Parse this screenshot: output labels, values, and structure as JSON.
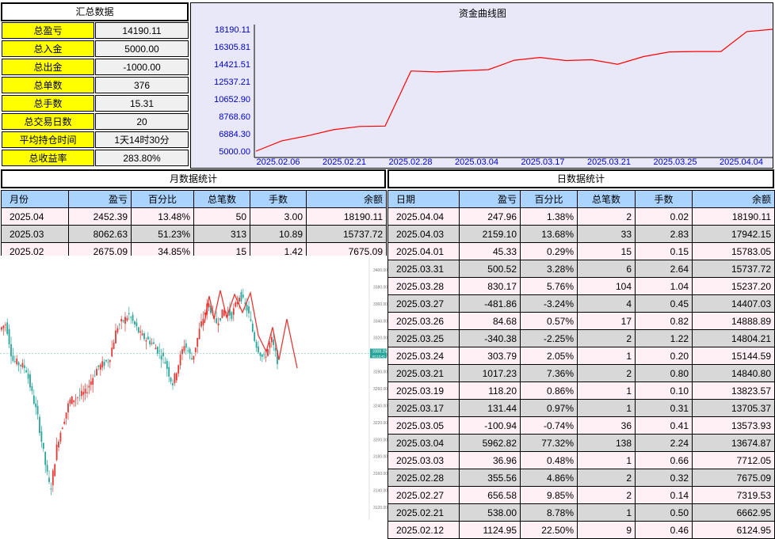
{
  "summary": {
    "title": "汇总数据",
    "rows": [
      {
        "label": "总盈亏",
        "value": "14190.11"
      },
      {
        "label": "总入金",
        "value": "5000.00"
      },
      {
        "label": "总出金",
        "value": "-1000.00"
      },
      {
        "label": "总单数",
        "value": "376"
      },
      {
        "label": "总手数",
        "value": "15.31"
      },
      {
        "label": "总交易日数",
        "value": "20"
      },
      {
        "label": "平均持仓时间",
        "value": "1天14时30分"
      },
      {
        "label": "总收益率",
        "value": "283.80%"
      }
    ]
  },
  "chart_data": {
    "type": "line",
    "title": "资金曲线图",
    "x_labels": [
      "2025.02.06",
      "2025.02.21",
      "2025.02.28",
      "2025.03.04",
      "2025.03.17",
      "2025.03.21",
      "2025.03.25",
      "2025.04.04"
    ],
    "y_ticks": [
      "18190.11",
      "16305.81",
      "14421.51",
      "12537.21",
      "10652.90",
      "8768.60",
      "6884.30",
      "5000.00"
    ],
    "ylim": [
      5000.0,
      18190.11
    ],
    "values": [
      5000,
      6124.95,
      6662.95,
      7319.53,
      7675.09,
      7712.05,
      13674.87,
      13573.93,
      13705.37,
      13823.57,
      14840.8,
      15144.59,
      14804.21,
      14888.89,
      14407.03,
      15237.2,
      15737.72,
      15783.05,
      15783.05,
      17942.15,
      18190.11
    ],
    "line_color": "#ff0000",
    "background": "#e8e8f8",
    "tick_color": "#0000cc"
  },
  "monthly": {
    "title": "月数据统计",
    "headers": [
      "月份",
      "盈亏",
      "百分比",
      "总笔数",
      "手数",
      "余额"
    ],
    "rows": [
      [
        "2025.04",
        "2452.39",
        "13.48%",
        "50",
        "3.00",
        "18190.11"
      ],
      [
        "2025.03",
        "8062.63",
        "51.23%",
        "313",
        "10.89",
        "15737.72"
      ],
      [
        "2025.02",
        "2675.09",
        "34.85%",
        "15",
        "1.42",
        "7675.09"
      ]
    ]
  },
  "daily": {
    "title": "日数据统计",
    "headers": [
      "日期",
      "盈亏",
      "百分比",
      "总笔数",
      "手数",
      "余额"
    ],
    "rows": [
      [
        "2025.04.04",
        "247.96",
        "1.38%",
        "2",
        "0.02",
        "18190.11"
      ],
      [
        "2025.04.03",
        "2159.10",
        "13.68%",
        "33",
        "2.83",
        "17942.15"
      ],
      [
        "2025.04.01",
        "45.33",
        "0.29%",
        "15",
        "0.15",
        "15783.05"
      ],
      [
        "2025.03.31",
        "500.52",
        "3.28%",
        "6",
        "2.64",
        "15737.72"
      ],
      [
        "2025.03.28",
        "830.17",
        "5.76%",
        "104",
        "1.04",
        "15237.20"
      ],
      [
        "2025.03.27",
        "-481.86",
        "-3.24%",
        "4",
        "0.45",
        "14407.03"
      ],
      [
        "2025.03.26",
        "84.68",
        "0.57%",
        "17",
        "0.82",
        "14888.89"
      ],
      [
        "2025.03.25",
        "-340.38",
        "-2.25%",
        "2",
        "1.22",
        "14804.21"
      ],
      [
        "2025.03.24",
        "303.79",
        "2.05%",
        "1",
        "0.20",
        "15144.59"
      ],
      [
        "2025.03.21",
        "1017.23",
        "7.36%",
        "2",
        "0.80",
        "14840.80"
      ],
      [
        "2025.03.19",
        "118.20",
        "0.86%",
        "1",
        "0.10",
        "13823.57"
      ],
      [
        "2025.03.17",
        "131.44",
        "0.97%",
        "1",
        "0.31",
        "13705.37"
      ],
      [
        "2025.03.05",
        "-100.94",
        "-0.74%",
        "36",
        "0.41",
        "13573.93"
      ],
      [
        "2025.03.04",
        "5962.82",
        "77.32%",
        "138",
        "2.24",
        "13674.87"
      ],
      [
        "2025.03.03",
        "36.96",
        "0.48%",
        "1",
        "0.66",
        "7712.05"
      ],
      [
        "2025.02.28",
        "355.56",
        "4.86%",
        "2",
        "0.32",
        "7675.09"
      ],
      [
        "2025.02.27",
        "656.58",
        "9.85%",
        "2",
        "0.14",
        "7319.53"
      ],
      [
        "2025.02.21",
        "538.00",
        "8.78%",
        "1",
        "0.50",
        "6662.95"
      ],
      [
        "2025.02.12",
        "1124.95",
        "22.50%",
        "9",
        "0.46",
        "6124.95"
      ]
    ]
  },
  "overlay": {
    "price_labels": [
      "3400.00",
      "3380.00",
      "3360.00",
      "3340.00",
      "3320.00",
      "3300.00",
      "3280.00",
      "3260.00",
      "3240.00",
      "3220.00",
      "3200.00",
      "3180.00",
      "3160.00",
      "3140.00",
      "3120.00"
    ],
    "current_price": "3308.25",
    "current_sub": "00:15:45",
    "price_min": 3120,
    "price_max": 3410,
    "up_color": "#e53935",
    "down_color": "#26a69a"
  }
}
